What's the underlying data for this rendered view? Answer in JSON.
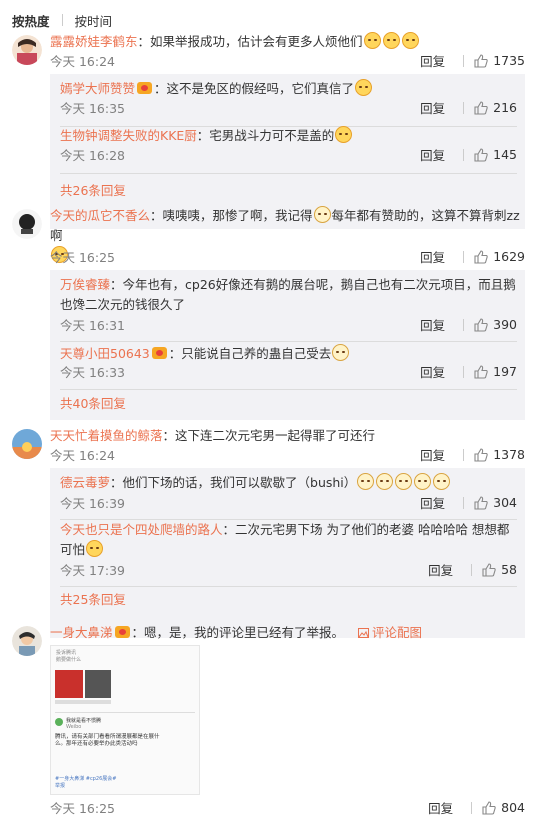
{
  "sort": {
    "hot": "按热度",
    "time": "按时间"
  },
  "reply_label": "回复",
  "comments": [
    {
      "user": "露露娇娃李鹤东",
      "text": "：如果举报成功，估计会有更多人烦他们",
      "time": "今天 16:24",
      "likes": "1735",
      "replies": [
        {
          "user": "嫣学大师赞赞",
          "text": "：这不是免区的假经吗，它们真信了",
          "time": "今天 16:35",
          "likes": "216"
        },
        {
          "user": "生物钟调整失败的KKE厨",
          "text": "：宅男战斗力可不是盖的",
          "time": "今天 16:28",
          "likes": "145"
        }
      ],
      "more": "共26条回复"
    },
    {
      "user": "今天的瓜它不香么",
      "text": "：咦咦咦，那惨了啊，我记得",
      "text2": "每年都有赞助的，这算不算背刺zz啊",
      "time": "今天 16:25",
      "likes": "1629",
      "replies": [
        {
          "user": "万俟睿臻",
          "text": "：今年也有，cp26好像还有鹅的展台呢，鹅自己也有二次元项目，而且鹅也馋二次元的钱很久了",
          "time": "今天 16:31",
          "likes": "390"
        },
        {
          "user": "天尊小田50643",
          "text": "：只能说自己养的蛊自己受去",
          "time": "今天 16:33",
          "likes": "197"
        }
      ],
      "more": "共40条回复"
    },
    {
      "user": "天天忙着摸鱼的鲸落",
      "text": "：这下连二次元宅男一起得罪了可还行",
      "time": "今天 16:24",
      "likes": "1378",
      "replies": [
        {
          "user": "德云毒萝",
          "text": "：他们下场的话，我们可以歇歇了（bushi）",
          "time": "今天 16:39",
          "likes": "304"
        },
        {
          "user": "今天也只是个四处爬墙的路人",
          "text": "：二次元宅男下场 为了他们的老婆 哈哈哈哈 想想都可怕",
          "time": "今天 17:39",
          "likes": "58"
        }
      ],
      "more": "共25条回复"
    },
    {
      "user": "一身大鼻涕",
      "text": "：嗯，是，我的评论里已经有了举报。",
      "pic_link": "评论配图",
      "time": "今天 16:25",
      "likes": "804",
      "thumb": {
        "line1": "投诉腾讯",
        "line2": "鹅要做什么",
        "card_title": "我就是看不惯腾",
        "card_sub": "Weibo",
        "card_text": "腾讯，请有关部门看看所谓漫展都是在展什么。那年还有必要举办此类活动吗",
        "tag1": "#一身大鼻涕 #cp26展会#",
        "tag2": "举报"
      }
    }
  ]
}
